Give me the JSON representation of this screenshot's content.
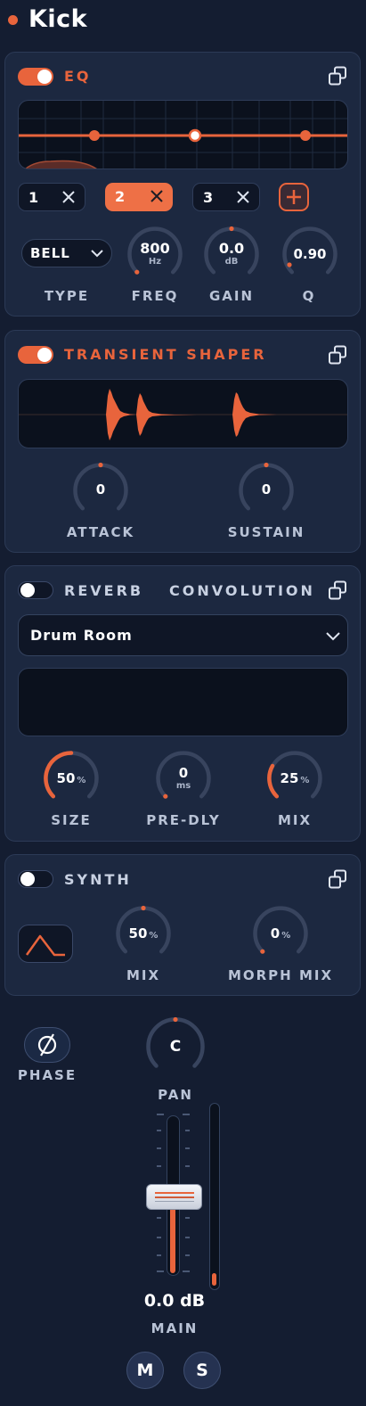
{
  "track": {
    "title": "Kick"
  },
  "eq": {
    "label": "EQ",
    "enabled": true,
    "bands": [
      {
        "number": "1",
        "active": false
      },
      {
        "number": "2",
        "active": true
      },
      {
        "number": "3",
        "active": false
      }
    ],
    "type": {
      "label": "TYPE",
      "value": "BELL"
    },
    "freq": {
      "label": "FREQ",
      "value": "800",
      "unit": "Hz"
    },
    "gain": {
      "label": "GAIN",
      "value": "0.0",
      "unit": "dB"
    },
    "q": {
      "label": "Q",
      "value": "0.90"
    }
  },
  "transient_shaper": {
    "label": "TRANSIENT SHAPER",
    "enabled": true,
    "attack": {
      "label": "ATTACK",
      "value": "0"
    },
    "sustain": {
      "label": "SUSTAIN",
      "value": "0"
    }
  },
  "reverb": {
    "label": "REVERB",
    "mode": "CONVOLUTION",
    "enabled": false,
    "preset": "Drum Room",
    "size": {
      "label": "SIZE",
      "value": "50",
      "unit": "%"
    },
    "pre_delay": {
      "label": "PRE-DLY",
      "value": "0",
      "unit": "ms"
    },
    "mix": {
      "label": "MIX",
      "value": "25",
      "unit": "%"
    }
  },
  "synth": {
    "label": "SYNTH",
    "enabled": false,
    "mix": {
      "label": "MIX",
      "value": "50",
      "unit": "%"
    },
    "morph_mix": {
      "label": "MORPH MIX",
      "value": "0",
      "unit": "%"
    }
  },
  "channel": {
    "phase_label": "PHASE",
    "pan": {
      "label": "PAN",
      "value": "C"
    },
    "main": {
      "label": "MAIN",
      "value": "0.0 dB"
    },
    "mute_label": "M",
    "solo_label": "S"
  },
  "colors": {
    "accent": "#e8643c",
    "background": "#141d31",
    "panel": "#1c2840"
  },
  "icons": {
    "copy": "copy-icon",
    "chevron": "chevron-down-icon",
    "close": "close-icon",
    "plus": "plus-icon",
    "phase": "phase-invert-icon",
    "waveform": "triangle-wave-icon"
  }
}
